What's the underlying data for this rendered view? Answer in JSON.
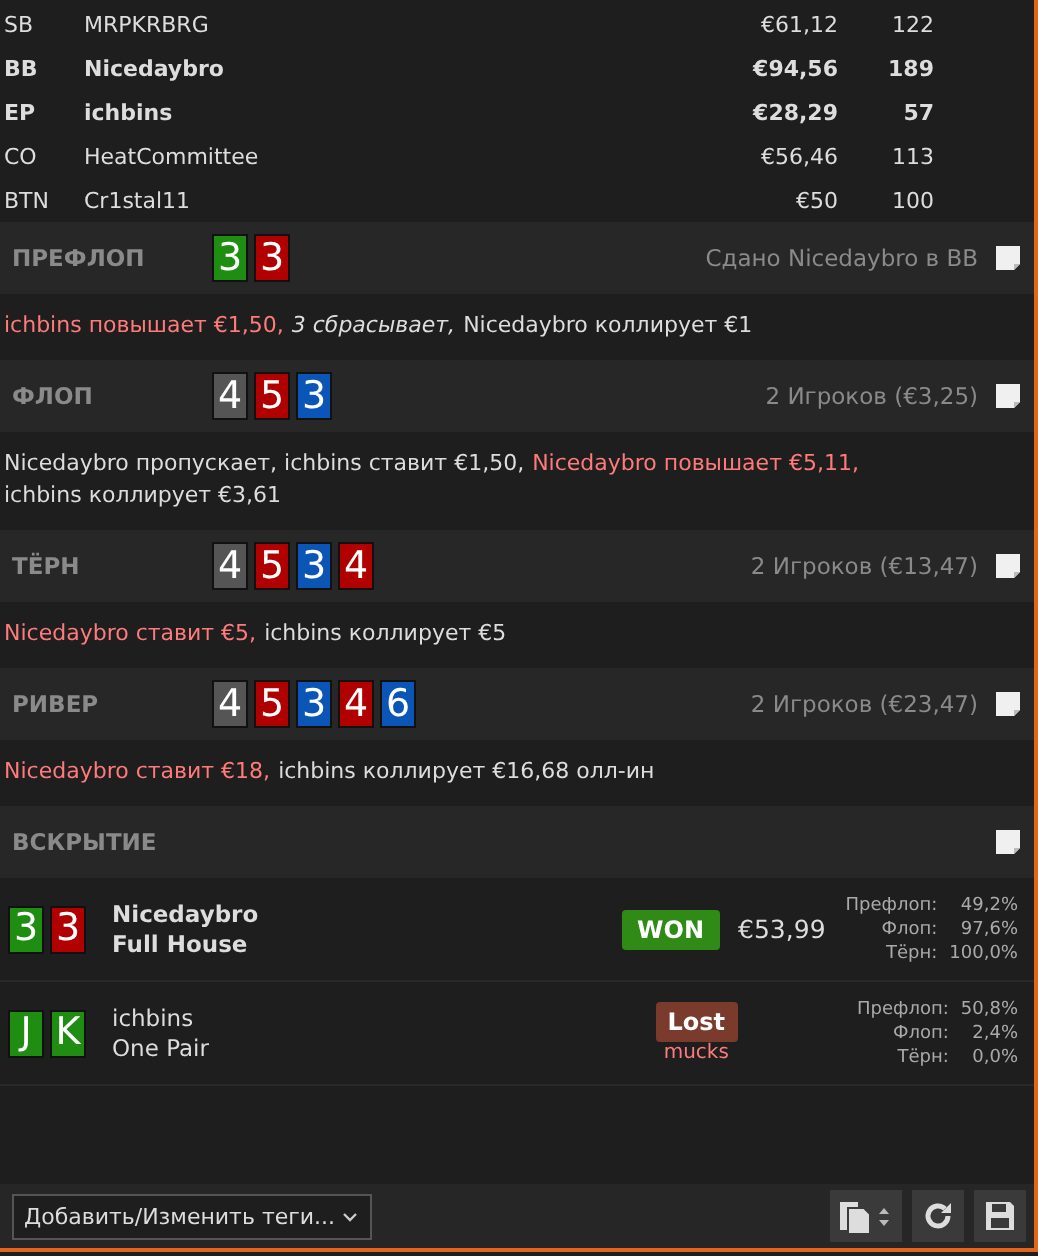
{
  "players": [
    {
      "position": "SB",
      "name": "MRPKRBRG",
      "stack": "€61,12",
      "bb": "122",
      "bold": false
    },
    {
      "position": "BB",
      "name": "Nicedaybro",
      "stack": "€94,56",
      "bb": "189",
      "bold": true
    },
    {
      "position": "EP",
      "name": "ichbins",
      "stack": "€28,29",
      "bb": "57",
      "bold": true
    },
    {
      "position": "CO",
      "name": "HeatCommittee",
      "stack": "€56,46",
      "bb": "113",
      "bold": false
    },
    {
      "position": "BTN",
      "name": "Cr1stal11",
      "stack": "€50",
      "bb": "100",
      "bold": false
    }
  ],
  "streets": [
    {
      "title": "ПРЕФЛОП",
      "cards": [
        {
          "rank": "3",
          "color": "#1f8c12"
        },
        {
          "rank": "3",
          "color": "#b00000"
        }
      ],
      "info": "Сдано Nicedaybro в BB",
      "actions": [
        {
          "text": "ichbins повышает €1,50,",
          "kind": "aggressive"
        },
        {
          "text": "3 сбрасывает,",
          "kind": "fold"
        },
        {
          "text": "Nicedaybro коллирует €1",
          "kind": "normal"
        }
      ]
    },
    {
      "title": "ФЛОП",
      "cards": [
        {
          "rank": "4",
          "color": "#555555"
        },
        {
          "rank": "5",
          "color": "#b00000"
        },
        {
          "rank": "3",
          "color": "#0a55b5"
        }
      ],
      "info": "2 Игроков (€3,25)",
      "actions": [
        {
          "text": "Nicedaybro пропускает, ichbins ставит €1,50,",
          "kind": "normal"
        },
        {
          "text": "Nicedaybro повышает €5,11,",
          "kind": "aggressive"
        },
        {
          "text": "ichbins коллирует €3,61",
          "kind": "normal"
        }
      ]
    },
    {
      "title": "ТЁРН",
      "cards": [
        {
          "rank": "4",
          "color": "#555555"
        },
        {
          "rank": "5",
          "color": "#b00000"
        },
        {
          "rank": "3",
          "color": "#0a55b5"
        },
        {
          "rank": "4",
          "color": "#b00000"
        }
      ],
      "info": "2 Игроков (€13,47)",
      "actions": [
        {
          "text": "Nicedaybro ставит €5,",
          "kind": "aggressive"
        },
        {
          "text": "ichbins коллирует €5",
          "kind": "normal"
        }
      ]
    },
    {
      "title": "РИВЕР",
      "cards": [
        {
          "rank": "4",
          "color": "#555555"
        },
        {
          "rank": "5",
          "color": "#b00000"
        },
        {
          "rank": "3",
          "color": "#0a55b5"
        },
        {
          "rank": "4",
          "color": "#b00000"
        },
        {
          "rank": "6",
          "color": "#0a55b5"
        }
      ],
      "info": "2 Игроков (€23,47)",
      "actions": [
        {
          "text": "Nicedaybro ставит €18,",
          "kind": "aggressive"
        },
        {
          "text": "ichbins коллирует €16,68 олл-ин",
          "kind": "normal"
        }
      ]
    }
  ],
  "showdown": {
    "title": "ВСКРЫТИЕ",
    "hands": [
      {
        "cards": [
          {
            "rank": "3",
            "color": "#1f8c12"
          },
          {
            "rank": "3",
            "color": "#b00000"
          }
        ],
        "name": "Nicedaybro",
        "hand": "Full House",
        "bold": true,
        "result": {
          "kind": "won",
          "label": "WON",
          "amount": "€53,99"
        },
        "equity": [
          {
            "label": "Префлоп:",
            "value": "49,2%"
          },
          {
            "label": "Флоп:",
            "value": "97,6%"
          },
          {
            "label": "Тёрн:",
            "value": "100,0%"
          }
        ]
      },
      {
        "cards": [
          {
            "rank": "J",
            "color": "#1f8c12"
          },
          {
            "rank": "K",
            "color": "#1f8c12"
          }
        ],
        "name": "ichbins",
        "hand": "One Pair",
        "bold": false,
        "result": {
          "kind": "lost",
          "label": "Lost",
          "note": "mucks"
        },
        "equity": [
          {
            "label": "Префлоп:",
            "value": "50,8%"
          },
          {
            "label": "Флоп:",
            "value": "2,4%"
          },
          {
            "label": "Тёрн:",
            "value": "0,0%"
          }
        ]
      }
    ]
  },
  "footer": {
    "tags_dropdown": "Добавить/Изменить теги..."
  }
}
